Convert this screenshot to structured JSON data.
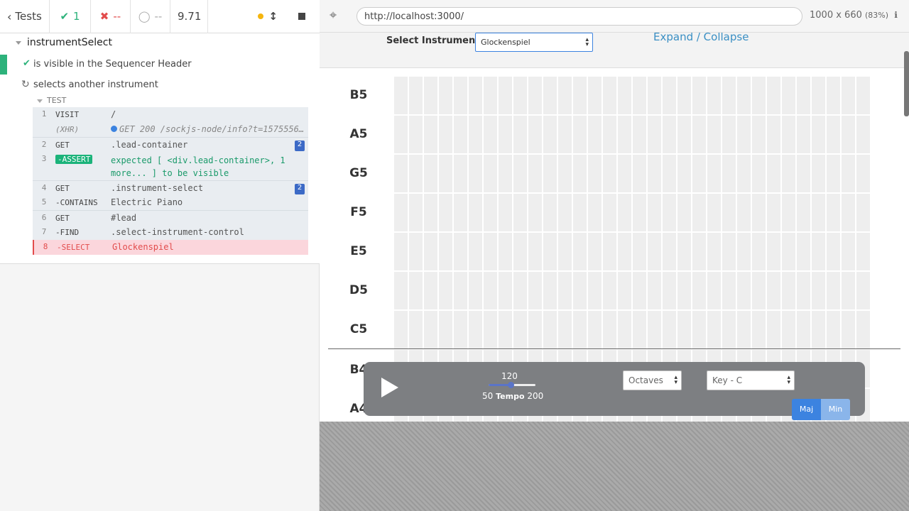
{
  "runner": {
    "back_label": "Tests",
    "passed": "1",
    "failed": "--",
    "pending": "--",
    "duration": "9.71"
  },
  "suite": {
    "title": "instrumentSelect",
    "tests": [
      {
        "title": "is visible in the Sequencer Header",
        "state": "passed"
      },
      {
        "title": "selects another instrument",
        "state": "running"
      }
    ],
    "section_label": "TEST",
    "commands": [
      {
        "num": "1",
        "name": "VISIT",
        "msg": "/"
      },
      {
        "num": "",
        "name": "(XHR)",
        "msg": "GET 200 /sockjs-node/info?t=1575556…"
      },
      {
        "num": "2",
        "name": "GET",
        "msg": ".lead-container",
        "count": "2"
      },
      {
        "num": "3",
        "name": "-ASSERT",
        "msg": "expected [ <div.lead-container>, 1 more... ] to be visible"
      },
      {
        "num": "4",
        "name": "GET",
        "msg": ".instrument-select",
        "count": "2"
      },
      {
        "num": "5",
        "name": "-CONTAINS",
        "msg": "Electric Piano"
      },
      {
        "num": "6",
        "name": "GET",
        "msg": "#lead"
      },
      {
        "num": "7",
        "name": "-FIND",
        "msg": ".select-instrument-control"
      },
      {
        "num": "8",
        "name": "-SELECT",
        "msg": "Glockenspiel"
      }
    ]
  },
  "browser": {
    "url": "http://localhost:3000/",
    "viewport": "1000 x 660",
    "zoom": "(83%)"
  },
  "app": {
    "select_instrument_label": "Select Instrument",
    "instrument_value": "Glockenspiel",
    "expand_label": "Expand / Collapse",
    "notes": [
      "B5",
      "A5",
      "G5",
      "F5",
      "E5",
      "D5",
      "C5",
      "B4",
      "A4"
    ],
    "tempo_value": "120",
    "tempo_min": "50",
    "tempo_label": "Tempo",
    "tempo_max": "200",
    "tempo_fraction": 0.47,
    "octaves_label": "Octaves",
    "key_label": "Key - C",
    "maj_label": "Maj",
    "min_label": "Min"
  },
  "colors": {
    "pass": "#2db27b",
    "fail": "#e24c4c",
    "accent": "#3c83e0",
    "link": "#3a8fc4"
  }
}
